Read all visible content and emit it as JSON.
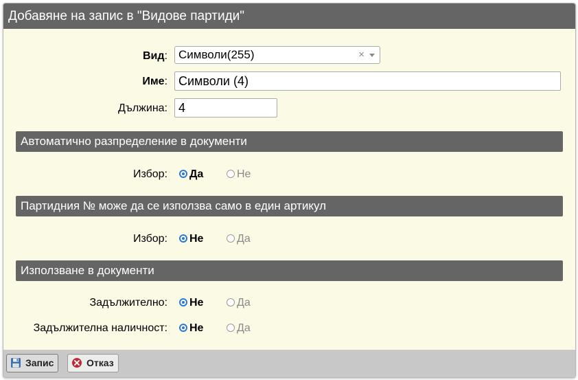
{
  "dialog": {
    "title": "Добавяне на запис в \"Видове партиди\""
  },
  "fields": {
    "type": {
      "label": "Вид",
      "value": "Символи(255)",
      "clear_glyph": "×"
    },
    "name": {
      "label": "Име",
      "value": "Символи (4)"
    },
    "length": {
      "label": "Дължина:",
      "value": "4"
    }
  },
  "sections": [
    {
      "title": "Автоматично разпределение в документи",
      "rows": [
        {
          "label": "Избор:",
          "options": [
            {
              "label": "Да",
              "checked": true
            },
            {
              "label": "Не",
              "checked": false
            }
          ]
        }
      ]
    },
    {
      "title": "Партидния № може да се използва само в един артикул",
      "rows": [
        {
          "label": "Избор:",
          "options": [
            {
              "label": "Не",
              "checked": true
            },
            {
              "label": "Да",
              "checked": false
            }
          ]
        }
      ]
    },
    {
      "title": "Използване в документи",
      "rows": [
        {
          "label": "Задължително:",
          "options": [
            {
              "label": "Не",
              "checked": true
            },
            {
              "label": "Да",
              "checked": false
            }
          ]
        },
        {
          "label": "Задължителна наличност:",
          "options": [
            {
              "label": "Не",
              "checked": true
            },
            {
              "label": "Да",
              "checked": false
            }
          ]
        }
      ]
    }
  ],
  "footer": {
    "save_label": "Запис",
    "cancel_label": "Отказ",
    "save_icon": "floppy-disk-icon",
    "cancel_icon": "cancel-circle-icon"
  },
  "colors": {
    "header": "#656565",
    "background": "#fbfae5",
    "radio_accent": "#2b79d6",
    "cancel_red": "#c0282d"
  }
}
